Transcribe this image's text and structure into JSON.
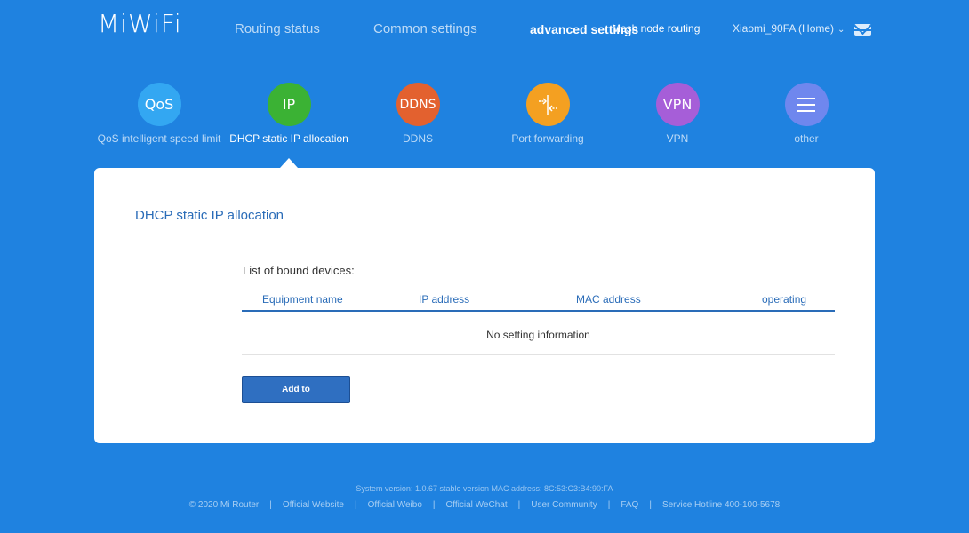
{
  "header": {
    "logo": "MiWiFi",
    "nav_routing": "Routing status",
    "nav_common": "Common settings",
    "nav_advanced": "advanced settings",
    "nav_mesh": "Mesh node routing",
    "device_name": "Xiaomi_90FA (Home)",
    "mail_icon": "envelope-icon"
  },
  "features": [
    {
      "icon_text": "QoS",
      "label": "QoS intelligent speed limit",
      "color": "#33a7f2"
    },
    {
      "icon_text": "IP",
      "label": "DHCP static IP allocation",
      "color": "#3bb234"
    },
    {
      "icon_text": "DDNS",
      "label": "DDNS",
      "color": "#e3612f"
    },
    {
      "icon_text": "",
      "label": "Port forwarding",
      "color": "#f4a021",
      "icon": "port-forward-icon"
    },
    {
      "icon_text": "VPN",
      "label": "VPN",
      "color": "#a65ed8"
    },
    {
      "icon_text": "",
      "label": "other",
      "color": "#6f87ee",
      "icon": "menu-icon"
    }
  ],
  "panel": {
    "title": "DHCP static IP allocation",
    "list_title": "List of bound devices:",
    "columns": [
      "Equipment name",
      "IP address",
      "MAC address",
      "operating"
    ],
    "empty_text": "No setting information",
    "add_button": "Add to"
  },
  "footer": {
    "system_info": "System version: 1.0.67 stable version MAC address: 8C:53:C3:B4:90:FA",
    "links": [
      "© 2020 Mi Router",
      "Official Website",
      "Official Weibo",
      "Official WeChat",
      "User Community",
      "FAQ",
      "Service Hotline 400-100-5678"
    ]
  }
}
